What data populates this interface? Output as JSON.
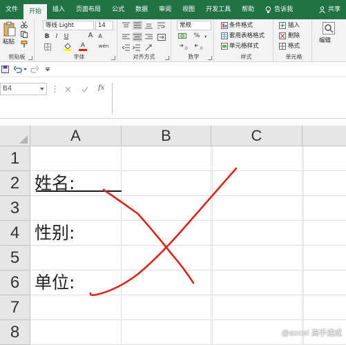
{
  "ribbon_tabs": [
    "文件",
    "开始",
    "插入",
    "页面布局",
    "公式",
    "数据",
    "审阅",
    "视图",
    "开发工具",
    "帮助"
  ],
  "tell_me": "告诉我",
  "share": "共享",
  "clipboard": {
    "label": "剪贴板",
    "paste": "粘贴"
  },
  "font": {
    "label": "字体",
    "name": "等线 Light",
    "size": "14",
    "bold": "B",
    "italic": "I",
    "underline": "U",
    "grow": "A",
    "shrink": "A",
    "color_letter": "A",
    "wen": "wén"
  },
  "alignment": {
    "label": "对齐方式"
  },
  "number": {
    "label": "数字",
    "format": "常规",
    "percent": "%",
    "comma": ","
  },
  "styles": {
    "label": "样式",
    "conditional": "条件格式",
    "table": "套用表格格式",
    "cell_styles": "单元格样式"
  },
  "cells": {
    "label": "单元格",
    "insert": "插入",
    "delete": "删除",
    "format": "格式"
  },
  "editing": {
    "label": "编辑"
  },
  "name_box": "B4",
  "fx": "fx",
  "columns": [
    "A",
    "B",
    "C"
  ],
  "rows": [
    "1",
    "2",
    "3",
    "4",
    "5",
    "6",
    "7",
    "8"
  ],
  "cells_text": {
    "a2": "姓名:",
    "a4": "性别:",
    "a6": "单位:"
  },
  "watermark": "@excel 高手速成",
  "colors": {
    "accent": "#217346",
    "ink": "#d9231b"
  }
}
